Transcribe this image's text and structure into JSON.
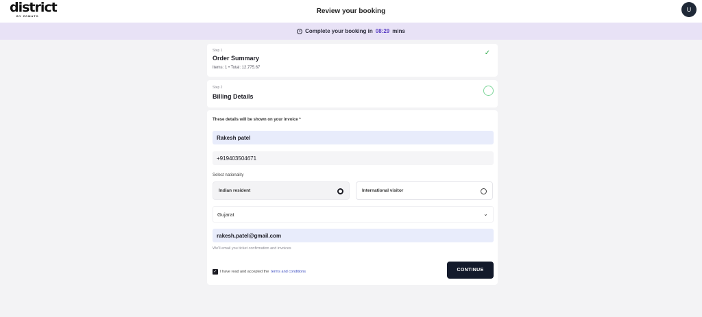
{
  "header": {
    "logo_main": "district",
    "logo_sub": "BY ZOMATO",
    "title": "Review your booking",
    "avatar_initial": "U"
  },
  "timer": {
    "prefix": "Complete your booking in",
    "time": "08:29",
    "suffix": "mins"
  },
  "step1": {
    "label": "Step 1",
    "title": "Order Summary",
    "meta": "Items: 1 • Total: 12,775.67",
    "status_icon": "check-icon"
  },
  "step2": {
    "label": "Step 2",
    "title": "Billing Details",
    "status_icon": "ring-icon"
  },
  "form": {
    "heading": "These details will be shown on your invoice *",
    "name_value": "Rakesh patel",
    "phone_value": "+919403504671",
    "nationality_label": "Select nationality",
    "options": [
      {
        "label": "Indian resident",
        "selected": true
      },
      {
        "label": "International visitor",
        "selected": false
      }
    ],
    "state_value": "Gujarat",
    "email_value": "rakesh.patel@gmail.com",
    "email_hint": "We'll email you ticket confirmation and invoices",
    "terms_prefix": "I have read and accepted the",
    "terms_link": "terms and conditions",
    "terms_checked": true,
    "continue_label": "CONTINUE"
  },
  "colors": {
    "timer_bg": "#e8e2f6",
    "accent_time": "#5b3fc4",
    "button_bg": "#131a2b",
    "check_green": "#28a745"
  }
}
